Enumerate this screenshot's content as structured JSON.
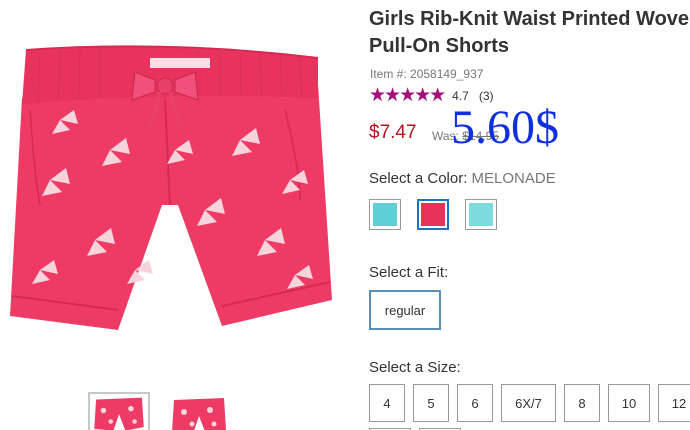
{
  "product": {
    "title_line1": "Girls Rib-Knit Waist Printed Wove",
    "title_line2": "Pull-On Shorts",
    "item_number": "Item #: 2058149_937",
    "stars": "★★★★★",
    "rating_value": "4.7",
    "review_count": "(3)",
    "rating_fraction": 0.94
  },
  "pricing": {
    "sale_price": "$7.47",
    "was_label": "Was: ",
    "was_price": "$14.95",
    "overlay_price": "5.60$",
    "overlay_color": "#1030e0",
    "sale_color": "#b5121b"
  },
  "color_picker": {
    "label": "Select a Color: ",
    "selected": "MELONADE",
    "swatches": [
      {
        "name": "turquoise",
        "hex": "#5fcfd6"
      },
      {
        "name": "melonade",
        "hex": "#e8325a",
        "selected": true
      },
      {
        "name": "aqua",
        "hex": "#7ddbe0"
      }
    ]
  },
  "fit_picker": {
    "label": "Select a Fit:",
    "options": [
      "regular"
    ]
  },
  "size_picker": {
    "label": "Select a Size:",
    "options": [
      "4",
      "5",
      "6",
      "6X/7",
      "8",
      "10",
      "12"
    ]
  },
  "colors": {
    "rating_star": "#a2127a",
    "active_border": "#1a73c9"
  }
}
